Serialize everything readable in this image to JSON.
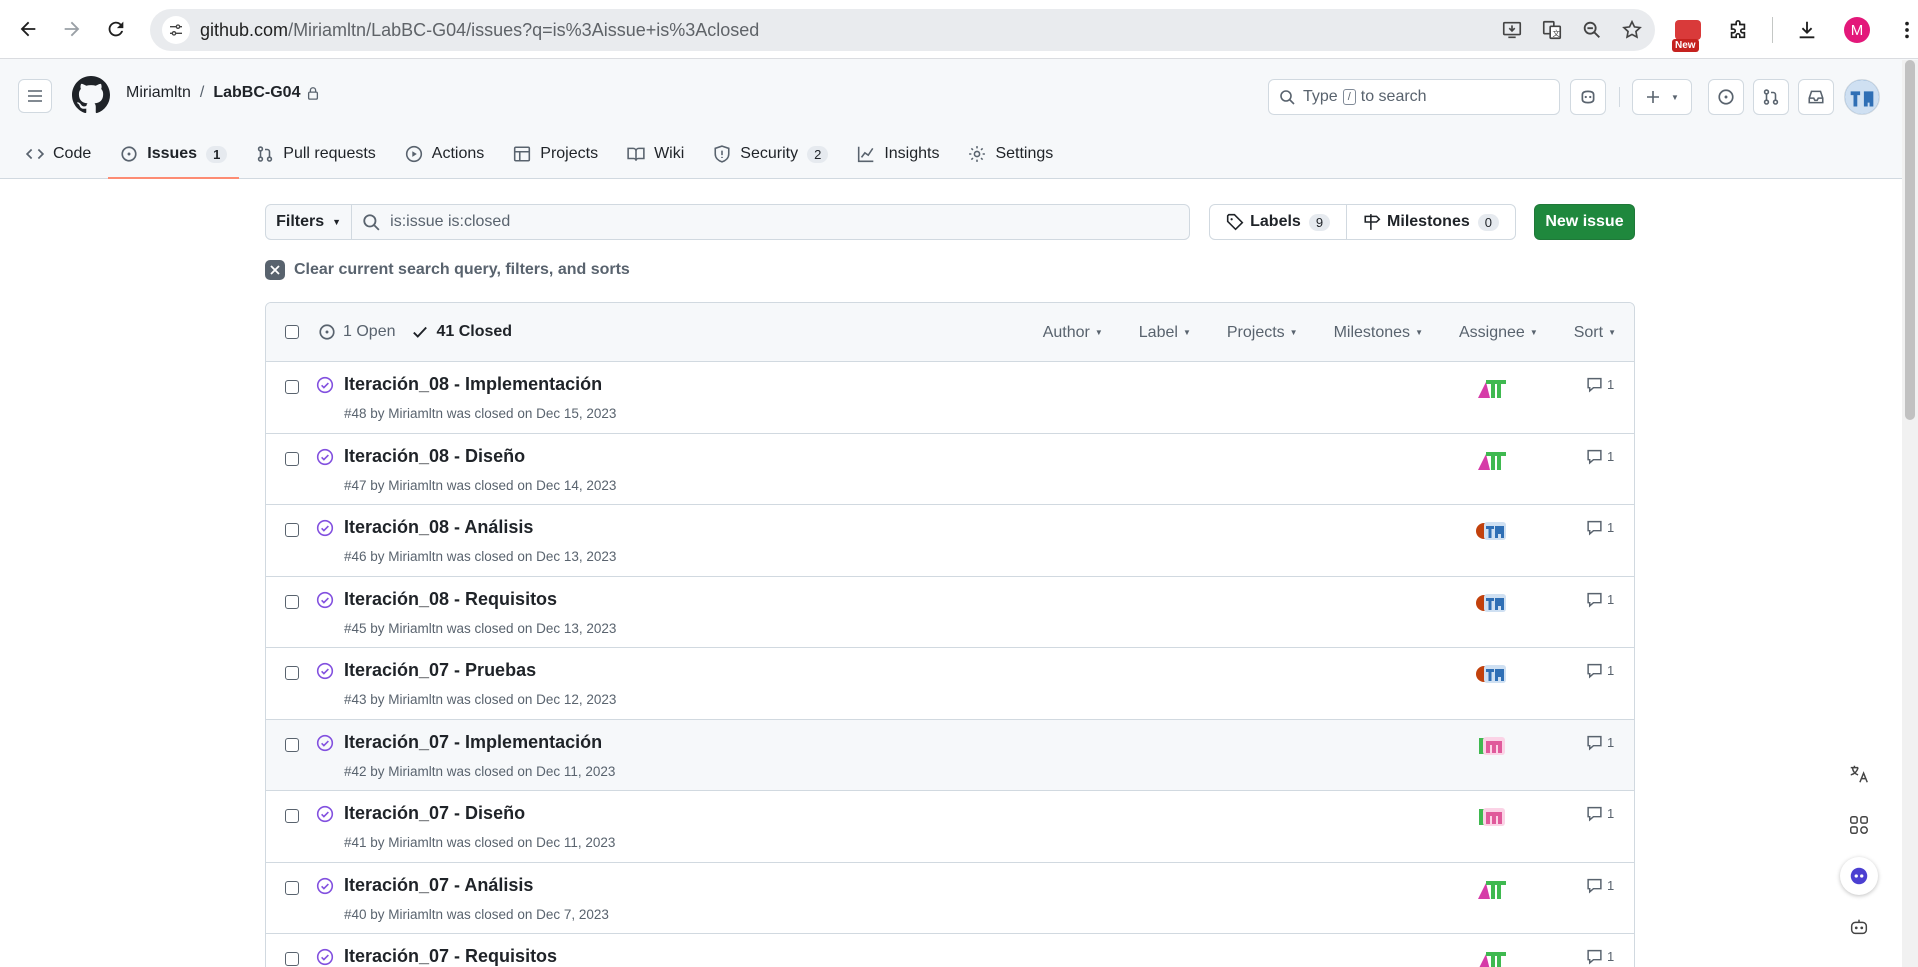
{
  "browser": {
    "url_host": "github.com",
    "url_path": "/Miriamltn/LabBC-G04/issues?q=is%3Aissue+is%3Aclosed",
    "new_badge": "New",
    "profile_initial": "M"
  },
  "header": {
    "owner": "Miriamltn",
    "separator": "/",
    "repo": "LabBC-G04",
    "search_prefix": "Type",
    "search_key": "/",
    "search_suffix": "to search"
  },
  "tabs": [
    {
      "label": "Code",
      "icon": "code-icon"
    },
    {
      "label": "Issues",
      "count": "1",
      "icon": "issue-opened-icon"
    },
    {
      "label": "Pull requests",
      "icon": "pull-request-icon"
    },
    {
      "label": "Actions",
      "icon": "play-icon"
    },
    {
      "label": "Projects",
      "icon": "table-icon"
    },
    {
      "label": "Wiki",
      "icon": "book-icon"
    },
    {
      "label": "Security",
      "count": "2",
      "icon": "shield-icon"
    },
    {
      "label": "Insights",
      "icon": "graph-icon"
    },
    {
      "label": "Settings",
      "icon": "gear-icon"
    }
  ],
  "toolbar": {
    "filters_label": "Filters",
    "query": "is:issue is:closed",
    "labels_label": "Labels",
    "labels_count": "9",
    "milestones_label": "Milestones",
    "milestones_count": "0",
    "new_issue_label": "New issue",
    "clear_label": "Clear current search query, filters, and sorts"
  },
  "list_header": {
    "open_label": "1 Open",
    "closed_label": "41 Closed",
    "filters": [
      "Author",
      "Label",
      "Projects",
      "Milestones",
      "Assignee",
      "Sort"
    ]
  },
  "issues": [
    {
      "title": "Iteración_08 - Implementación",
      "meta": "#48 by Miriamltn was closed on Dec 15, 2023",
      "comments": "1",
      "avatar": "green"
    },
    {
      "title": "Iteración_08 - Diseño",
      "meta": "#47 by Miriamltn was closed on Dec 14, 2023",
      "comments": "1",
      "avatar": "green"
    },
    {
      "title": "Iteración_08 - Análisis",
      "meta": "#46 by Miriamltn was closed on Dec 13, 2023",
      "comments": "1",
      "avatar": "blue"
    },
    {
      "title": "Iteración_08 - Requisitos",
      "meta": "#45 by Miriamltn was closed on Dec 13, 2023",
      "comments": "1",
      "avatar": "blue"
    },
    {
      "title": "Iteración_07 - Pruebas",
      "meta": "#43 by Miriamltn was closed on Dec 12, 2023",
      "comments": "1",
      "avatar": "blue"
    },
    {
      "title": "Iteración_07 - Implementación",
      "meta": "#42 by Miriamltn was closed on Dec 11, 2023",
      "comments": "1",
      "avatar": "pink"
    },
    {
      "title": "Iteración_07 - Diseño",
      "meta": "#41 by Miriamltn was closed on Dec 11, 2023",
      "comments": "1",
      "avatar": "pink"
    },
    {
      "title": "Iteración_07 - Análisis",
      "meta": "#40 by Miriamltn was closed on Dec 7, 2023",
      "comments": "1",
      "avatar": "green"
    },
    {
      "title": "Iteración_07 - Requisitos",
      "meta": "",
      "comments": "1",
      "avatar": "green"
    }
  ],
  "colors": {
    "accent_tab": "#fd8c73",
    "new_issue_bg": "#1f883d",
    "closed_icon": "#8250df"
  }
}
